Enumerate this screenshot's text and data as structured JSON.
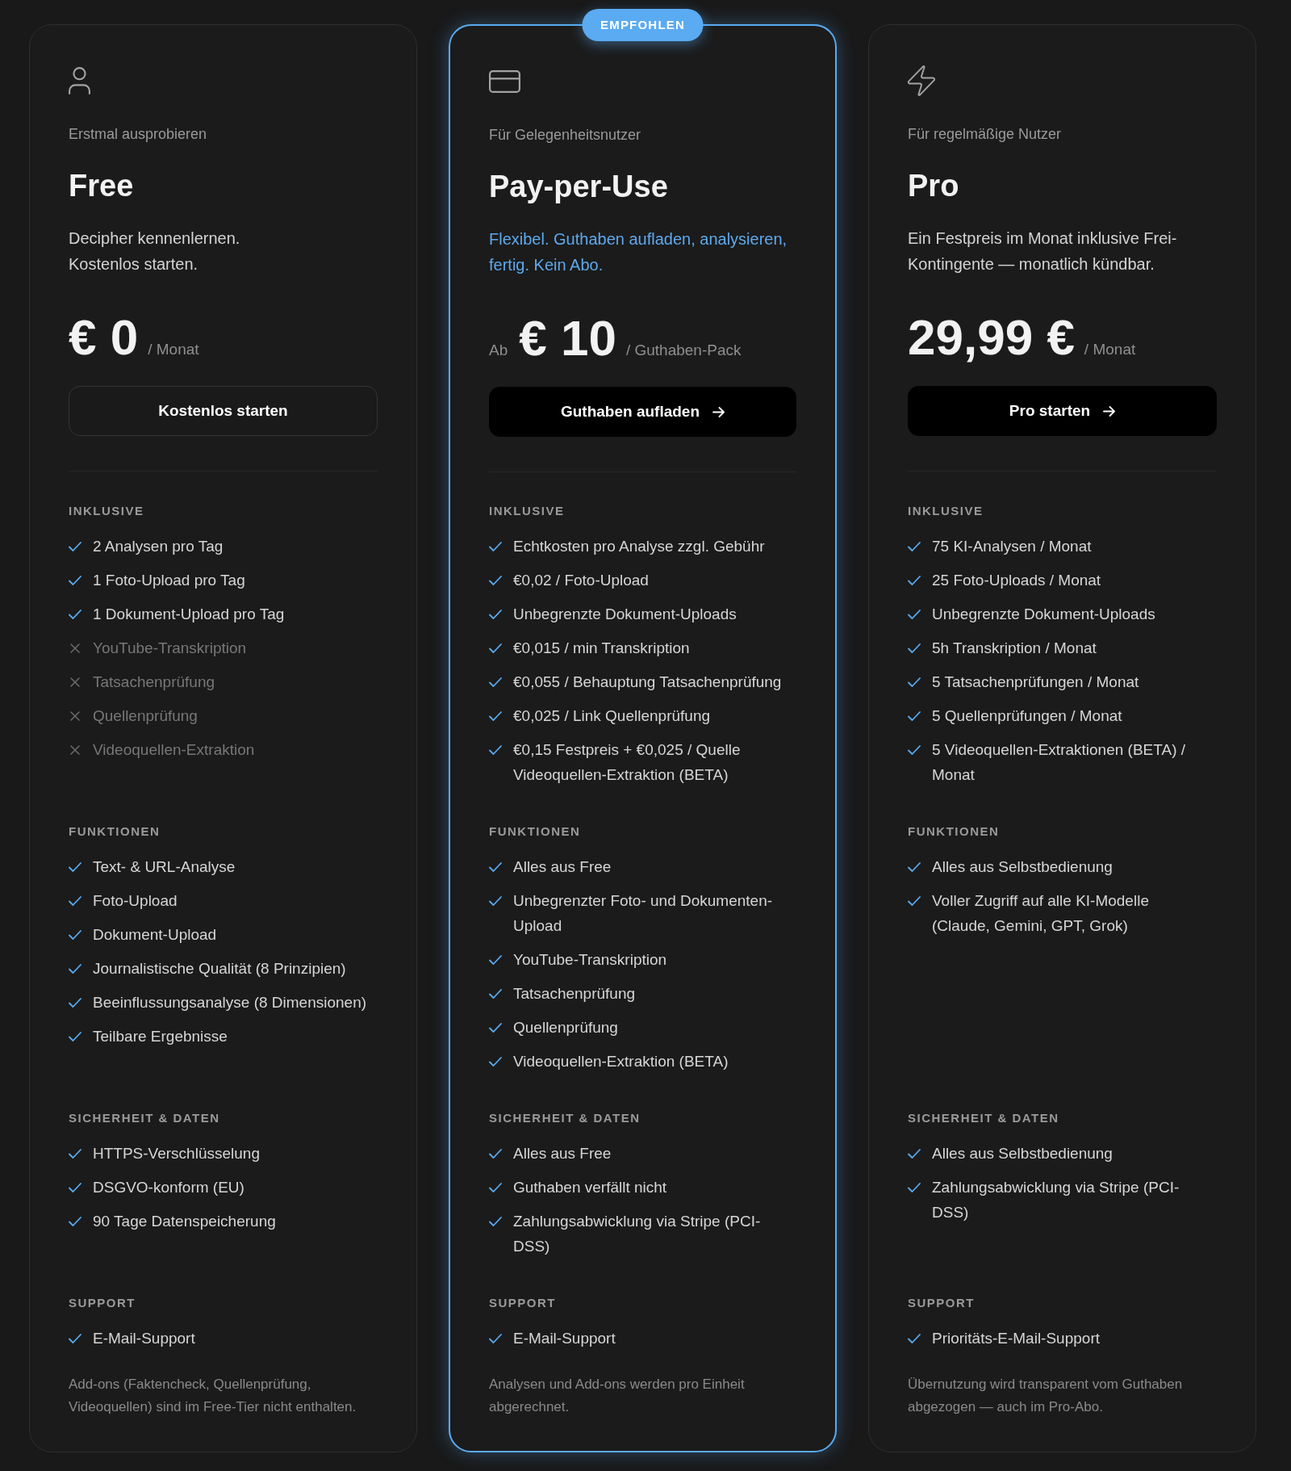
{
  "plans": [
    {
      "highlighted": false,
      "tagline": "Erstmal ausprobieren",
      "title": "Free",
      "description": "Decipher kennenlernen. Kostenlos starten.",
      "price": {
        "amount": "€ 0",
        "period": "/ Monat"
      },
      "button": {
        "label": "Kostenlos starten",
        "kind": "outline"
      },
      "sections": [
        {
          "heading": "INKLUSIVE",
          "items": [
            {
              "text": "2 Analysen pro Tag",
              "included": true
            },
            {
              "text": "1 Foto-Upload pro Tag",
              "included": true
            },
            {
              "text": "1 Dokument-Upload pro Tag",
              "included": true
            },
            {
              "text": "YouTube-Transkription",
              "included": false
            },
            {
              "text": "Tatsachenprüfung",
              "included": false
            },
            {
              "text": "Quellenprüfung",
              "included": false
            },
            {
              "text": "Videoquellen-Extraktion",
              "included": false
            }
          ]
        },
        {
          "heading": "FUNKTIONEN",
          "items": [
            {
              "text": "Text- & URL-Analyse",
              "included": true
            },
            {
              "text": "Foto-Upload",
              "included": true
            },
            {
              "text": "Dokument-Upload",
              "included": true
            },
            {
              "text": "Journalistische Qualität (8 Prinzipien)",
              "included": true
            },
            {
              "text": "Beeinflussungsanalyse (8 Dimensionen)",
              "included": true
            },
            {
              "text": "Teilbare Ergebnisse",
              "included": true
            }
          ]
        },
        {
          "heading": "SICHERHEIT & DATEN",
          "items": [
            {
              "text": "HTTPS-Verschlüsselung",
              "included": true
            },
            {
              "text": "DSGVO-konform (EU)",
              "included": true
            },
            {
              "text": "90 Tage Datenspeicherung",
              "included": true
            }
          ]
        },
        {
          "heading": "SUPPORT",
          "items": [
            {
              "text": "E-Mail-Support",
              "included": true
            }
          ]
        }
      ],
      "footnote": "Add-ons (Faktencheck, Quellenprüfung, Videoquellen) sind im Free-Tier nicht enthalten."
    },
    {
      "badge": "EMPFOHLEN",
      "highlighted": true,
      "tagline": "Für Gelegenheitsnutzer",
      "title": "Pay-per-Use",
      "description": "Flexibel. Guthaben aufladen, analysieren, fertig. Kein Abo.",
      "price": {
        "prefix": "Ab",
        "amount": "€ 10",
        "period": "/ Guthaben-Pack"
      },
      "button": {
        "label": "Guthaben aufladen",
        "kind": "primary"
      },
      "sections": [
        {
          "heading": "INKLUSIVE",
          "items": [
            {
              "text": "Echtkosten pro Analyse zzgl. Gebühr",
              "included": true
            },
            {
              "text": "€0,02 / Foto-Upload",
              "included": true
            },
            {
              "text": "Unbegrenzte Dokument-Uploads",
              "included": true
            },
            {
              "text": "€0,015 / min Transkription",
              "included": true
            },
            {
              "text": "€0,055 / Behauptung Tatsachenprüfung",
              "included": true
            },
            {
              "text": "€0,025 / Link Quellenprüfung",
              "included": true
            },
            {
              "text": "€0,15 Festpreis + €0,025 / Quelle Videoquellen-Extraktion (BETA)",
              "included": true
            }
          ]
        },
        {
          "heading": "FUNKTIONEN",
          "items": [
            {
              "text": "Alles aus Free",
              "included": true
            },
            {
              "text": "Unbegrenzter Foto- und Dokumenten-Upload",
              "included": true
            },
            {
              "text": "YouTube-Transkription",
              "included": true
            },
            {
              "text": "Tatsachenprüfung",
              "included": true
            },
            {
              "text": "Quellenprüfung",
              "included": true
            },
            {
              "text": "Videoquellen-Extraktion (BETA)",
              "included": true
            }
          ]
        },
        {
          "heading": "SICHERHEIT & DATEN",
          "items": [
            {
              "text": "Alles aus Free",
              "included": true
            },
            {
              "text": "Guthaben verfällt nicht",
              "included": true
            },
            {
              "text": "Zahlungsabwicklung via Stripe (PCI-DSS)",
              "included": true
            }
          ]
        },
        {
          "heading": "SUPPORT",
          "items": [
            {
              "text": "E-Mail-Support",
              "included": true
            }
          ]
        }
      ],
      "footnote": "Analysen und Add-ons werden pro Einheit abgerechnet."
    },
    {
      "highlighted": false,
      "tagline": "Für regelmäßige Nutzer",
      "title": "Pro",
      "description": "Ein Festpreis im Monat inklusive Frei-Kontingente — monatlich kündbar.",
      "price": {
        "amount": "29,99 €",
        "period": "/ Monat"
      },
      "button": {
        "label": "Pro starten",
        "kind": "primary"
      },
      "sections": [
        {
          "heading": "INKLUSIVE",
          "items": [
            {
              "text": "75 KI-Analysen / Monat",
              "included": true
            },
            {
              "text": "25 Foto-Uploads / Monat",
              "included": true
            },
            {
              "text": "Unbegrenzte Dokument-Uploads",
              "included": true
            },
            {
              "text": "5h Transkription / Monat",
              "included": true
            },
            {
              "text": "5 Tatsachenprüfungen / Monat",
              "included": true
            },
            {
              "text": "5 Quellenprüfungen / Monat",
              "included": true
            },
            {
              "text": "5 Videoquellen-Extraktionen (BETA) / Monat",
              "included": true
            }
          ]
        },
        {
          "heading": "FUNKTIONEN",
          "items": [
            {
              "text": "Alles aus Selbstbedienung",
              "included": true
            },
            {
              "text": "Voller Zugriff auf alle KI-Modelle (Claude, Gemini, GPT, Grok)",
              "included": true
            }
          ]
        },
        {
          "heading": "SICHERHEIT & DATEN",
          "items": [
            {
              "text": "Alles aus Selbstbedienung",
              "included": true
            },
            {
              "text": "Zahlungsabwicklung via Stripe (PCI-DSS)",
              "included": true
            }
          ]
        },
        {
          "heading": "SUPPORT",
          "items": [
            {
              "text": "Prioritäts-E-Mail-Support",
              "included": true
            }
          ]
        }
      ],
      "footnote": "Übernutzung wird transparent vom Guthaben abgezogen — auch im Pro-Abo."
    }
  ]
}
